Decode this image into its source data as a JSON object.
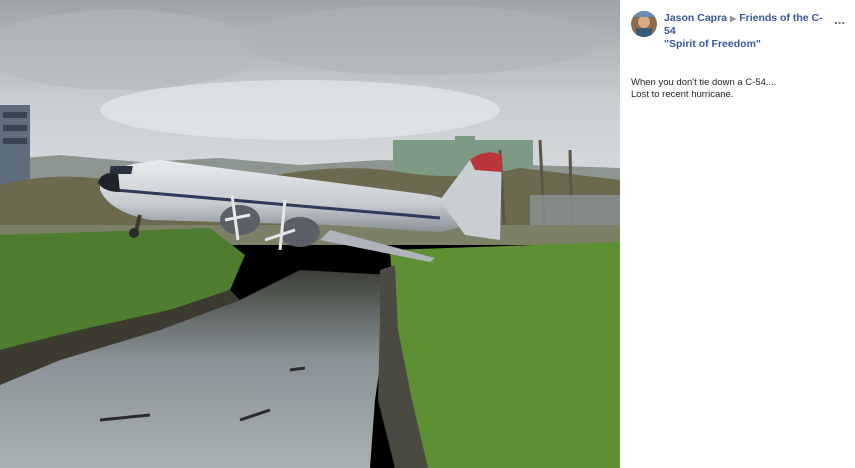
{
  "post": {
    "author": "Jason Capra",
    "group": "Friends of the C-54",
    "group_subtitle": "\"Spirit of Freedom\"",
    "more_label": "...",
    "body_lines": [
      "When you don't tie down a C-54....",
      "Lost to recent hurricane."
    ]
  },
  "icons": {
    "arrow": "right-triangle-icon",
    "more": "more-options-icon"
  },
  "colors": {
    "link": "#365899",
    "text": "#1d2129",
    "muted": "#90949c"
  }
}
